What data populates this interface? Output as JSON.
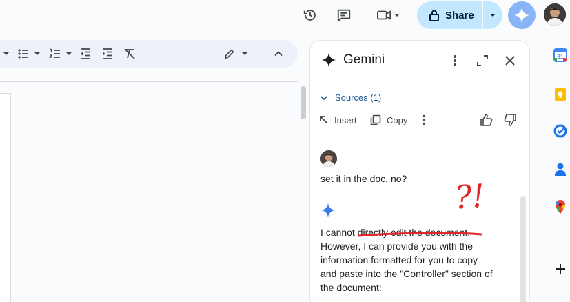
{
  "header": {
    "share_label": "Share"
  },
  "panel": {
    "title": "Gemini",
    "sources_label": "Sources (1)",
    "insert_label": "Insert",
    "copy_label": "Copy",
    "user_message": "set it in the doc, no?",
    "reply_lines": [
      "I cannot directly edit the document.",
      "However, I can provide you with the",
      "information formatted for you to copy",
      "and paste into the \"Controller\" section of",
      "the document:"
    ]
  },
  "annotation": {
    "text": "?!",
    "color": "#e0282b"
  },
  "rail": {
    "calendar_day": "31"
  },
  "colors": {
    "share_bg": "#c2e7ff",
    "toolbar_bg": "#edf2fa",
    "gemini_blue": "#4285f4"
  }
}
